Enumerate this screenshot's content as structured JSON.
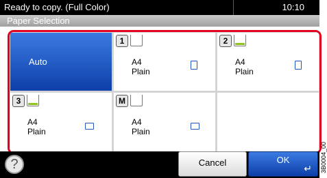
{
  "status": {
    "message": "Ready to copy. (Full Color)",
    "time": "10:10"
  },
  "screen_title": "Paper Selection",
  "tiles": {
    "auto": {
      "label": "Auto",
      "selected": true
    },
    "tray1": {
      "number": "1",
      "size": "A4",
      "type": "Plain",
      "orientation": "portrait"
    },
    "tray2": {
      "number": "2",
      "size": "A4",
      "type": "Plain",
      "orientation": "portrait"
    },
    "tray3": {
      "number": "3",
      "size": "A4",
      "type": "Plain",
      "orientation": "landscape"
    },
    "mp": {
      "number": "M",
      "size": "A4",
      "type": "Plain",
      "orientation": "landscape"
    }
  },
  "buttons": {
    "help": "?",
    "cancel": "Cancel",
    "ok": "OK"
  },
  "side_code": "3B0004_00",
  "colors": {
    "highlight": "#e1001e",
    "selected_blue": "#1a56c8",
    "paper_level": "#8dc21f"
  }
}
